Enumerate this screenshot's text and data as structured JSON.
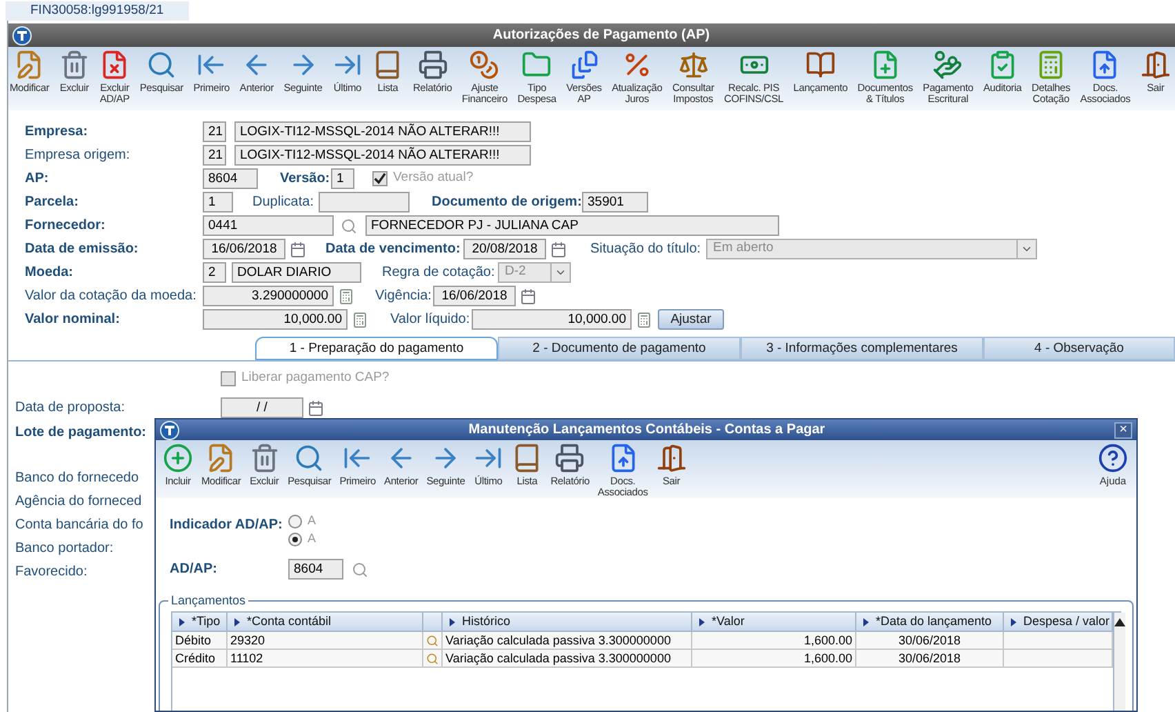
{
  "document_tab": {
    "label": "FIN30058:lg991958/21",
    "selected": true
  },
  "window": {
    "title": "Autorizações de Pagamento (AP)"
  },
  "toolbar": [
    {
      "label": "Modificar"
    },
    {
      "label": "Excluir"
    },
    {
      "label": "Excluir\nAD/AP"
    },
    {
      "label": "Pesquisar"
    },
    {
      "label": "Primeiro"
    },
    {
      "label": "Anterior"
    },
    {
      "label": "Seguinte"
    },
    {
      "label": "Último"
    },
    {
      "label": "Lista"
    },
    {
      "label": "Relatório"
    },
    {
      "label": "Ajuste\nFinanceiro"
    },
    {
      "label": "Tipo\nDespesa"
    },
    {
      "label": "Versões\nAP"
    },
    {
      "label": "Atualização\nJuros"
    },
    {
      "label": "Consultar\nImpostos"
    },
    {
      "label": "Recalc. PIS\nCOFINS/CSL"
    },
    {
      "label": "Lançamento"
    },
    {
      "label": "Documentos\n& Títulos"
    },
    {
      "label": "Pagamento\nEscritural"
    },
    {
      "label": "Auditoria"
    },
    {
      "label": "Detalhes\nCotação"
    },
    {
      "label": "Docs.\nAssociados"
    },
    {
      "label": "Sair"
    }
  ],
  "form": {
    "empresa": {
      "label": "Empresa:",
      "required": true,
      "code": "21",
      "name": "LOGIX-TI12-MSSQL-2014 NÃO ALTERAR!!!"
    },
    "empresa_origem": {
      "label": "Empresa origem:",
      "required": false,
      "code": "21",
      "name": "LOGIX-TI12-MSSQL-2014 NÃO ALTERAR!!!"
    },
    "ap": {
      "label": "AP:",
      "required": true,
      "value": "8604"
    },
    "versao": {
      "label": "Versão:",
      "required": true,
      "value": "1"
    },
    "versao_atual": {
      "label": "Versão atual?",
      "checked": true,
      "disabled": true
    },
    "parcela": {
      "label": "Parcela:",
      "required": true,
      "value": "1"
    },
    "duplicata": {
      "label": "Duplicata:",
      "required": false
    },
    "documento_origem": {
      "label": "Documento de origem:",
      "required": true,
      "value": "35901"
    },
    "fornecedor": {
      "label": "Fornecedor:",
      "required": true,
      "code": "0441",
      "name": "FORNECEDOR PJ - JULIANA CAP"
    },
    "data_emissao": {
      "label": "Data de emissão:",
      "required": true,
      "value": "16/06/2018"
    },
    "data_vencimento": {
      "label": "Data de vencimento:",
      "required": true,
      "value": "20/08/2018"
    },
    "situacao": {
      "label": "Situação do título:",
      "required": false,
      "value": "Em aberto",
      "disabled": true
    },
    "moeda": {
      "label": "Moeda:",
      "required": true,
      "code": "2",
      "name": "DOLAR DIARIO"
    },
    "regra_cotacao": {
      "label": "Regra de cotação:",
      "required": false,
      "value": "D-2",
      "disabled": true
    },
    "valor_cotacao": {
      "label": "Valor da cotação da moeda:",
      "required": false,
      "value": "3.290000000"
    },
    "vigencia": {
      "label": "Vigência:",
      "required": false,
      "value": "16/06/2018"
    },
    "valor_nominal": {
      "label": "Valor nominal:",
      "required": true,
      "value": "10,000.00"
    },
    "valor_liquido": {
      "label": "Valor líquido:",
      "required": false,
      "value": "10,000.00"
    },
    "ajustar": {
      "label": "Ajustar"
    }
  },
  "tabs": [
    {
      "label": "1 - Preparação do pagamento",
      "selected": true
    },
    {
      "label": "2 - Documento de pagamento",
      "selected": false
    },
    {
      "label": "3 - Informações complementares",
      "selected": false
    },
    {
      "label": "4 - Observação",
      "selected": false
    }
  ],
  "tab_content": {
    "liberar": {
      "label": "Liberar pagamento CAP?",
      "checked": false,
      "disabled": true
    },
    "data_proposta": {
      "label": "Data de proposta:",
      "value": "/ /"
    },
    "lote": {
      "label": "Lote de pagamento:",
      "required": true
    },
    "labels": [
      "Banco do fornecedo",
      "Agência do forneced",
      "Conta bancária do fo",
      "Banco portador:",
      "Favorecido:"
    ]
  },
  "dialog": {
    "title": "Manutenção Lançamentos Contábeis - Contas a Pagar",
    "close": "×",
    "toolbar": [
      {
        "label": "Incluir"
      },
      {
        "label": "Modificar"
      },
      {
        "label": "Excluir"
      },
      {
        "label": "Pesquisar"
      },
      {
        "label": "Primeiro"
      },
      {
        "label": "Anterior"
      },
      {
        "label": "Seguinte"
      },
      {
        "label": "Último"
      },
      {
        "label": "Lista"
      },
      {
        "label": "Relatório"
      },
      {
        "label": "Docs.\nAssociados"
      },
      {
        "label": "Sair"
      }
    ],
    "help": {
      "label": "Ajuda"
    },
    "indicador": {
      "label": "Indicador AD/AP:",
      "options": [
        {
          "label": "A",
          "selected": false
        },
        {
          "label": "A",
          "selected": true
        }
      ]
    },
    "adap": {
      "label": "AD/AP:",
      "value": "8604"
    },
    "group": {
      "title": "Lançamentos",
      "columns": [
        "*Tipo",
        "*Conta contábil",
        "Histórico",
        "*Valor",
        "*Data do lançamento",
        "Despesa / valor"
      ],
      "rows": [
        {
          "tipo": "Débito",
          "conta": "29320",
          "historico": "Variação calculada passiva 3.300000000",
          "valor": "1,600.00",
          "data": "30/06/2018"
        },
        {
          "tipo": "Crédito",
          "conta": "11102",
          "historico": "Variação calculada passiva 3.300000000",
          "valor": "1,600.00",
          "data": "30/06/2018"
        }
      ]
    }
  }
}
